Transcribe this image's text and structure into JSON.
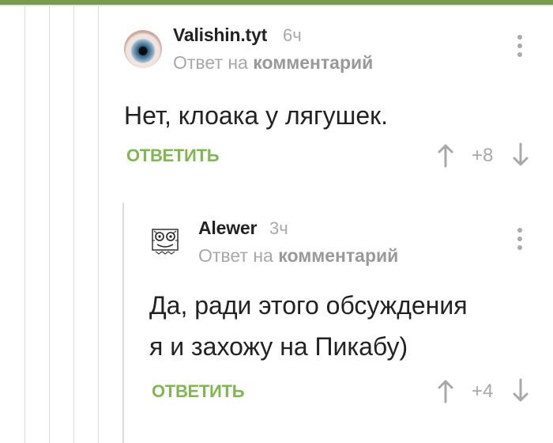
{
  "comments": [
    {
      "username": "Valishin.tyt",
      "time": "6ч",
      "reply_prefix": "Ответ на",
      "reply_target": "комментарий",
      "text": "Нет, клоака у лягушек.",
      "reply_label": "ОТВЕТИТЬ",
      "score": "+8",
      "avatar_icon": "eye-avatar"
    },
    {
      "username": "Alewer",
      "time": "3ч",
      "reply_prefix": "Ответ на",
      "reply_target": "комментарий",
      "text_line1": "Да, ради этого обсуждения",
      "text_line2": "я и захожу на Пикабу)",
      "reply_label": "ОТВЕТИТЬ",
      "score": "+4",
      "avatar_icon": "doodle-avatar"
    }
  ],
  "colors": {
    "accent_green": "#7eb84f",
    "top_bar": "#7a9a52",
    "muted_text": "#a8a8a8",
    "thread_line": "#dcdcdc"
  }
}
